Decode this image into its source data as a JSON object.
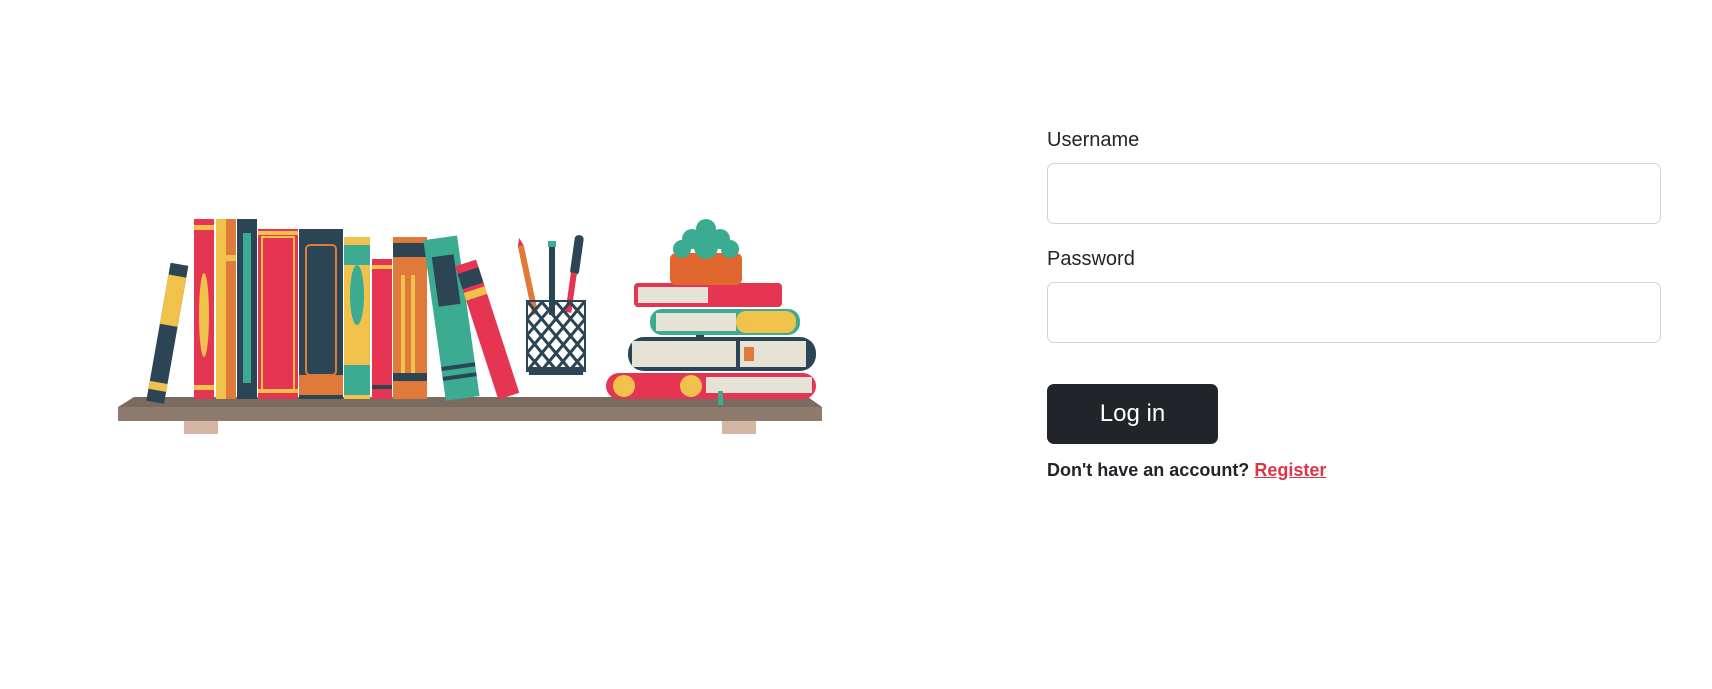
{
  "colors": {
    "primary_button": "#212529",
    "link": "#dc3545",
    "input_border": "#ced4da",
    "shelf": "#7a6a5f",
    "shelf_top": "#8f7b6e",
    "shelf_bracket": "#d5b6a5",
    "book_red": "#e63553",
    "book_yellow": "#f0c24c",
    "book_navy": "#2c4555",
    "book_teal": "#3bab92",
    "book_orange": "#e07a3a",
    "pot_orange": "#e0672d",
    "plant_green": "#3bab92"
  },
  "illustration": {
    "icon": "bookshelf-illustration"
  },
  "form": {
    "username_label": "Username",
    "username_value": "",
    "password_label": "Password",
    "password_value": "",
    "submit_label": "Log in",
    "register_prompt": "Don't have an account?",
    "register_link": "Register"
  }
}
